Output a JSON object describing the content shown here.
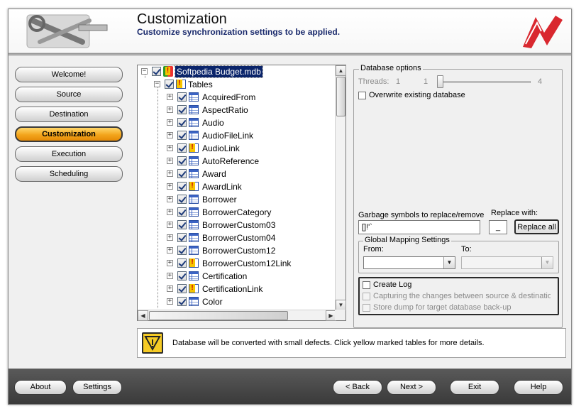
{
  "header": {
    "title": "Customization",
    "subtitle": "Customize synchronization settings to be applied."
  },
  "nav": [
    {
      "label": "Welcome!",
      "active": false
    },
    {
      "label": "Source",
      "active": false
    },
    {
      "label": "Destination",
      "active": false
    },
    {
      "label": "Customization",
      "active": true
    },
    {
      "label": "Execution",
      "active": false
    },
    {
      "label": "Scheduling",
      "active": false
    }
  ],
  "tree": {
    "root": "Softpedia Budget.mdb",
    "tables_node": "Tables",
    "items": [
      {
        "label": "AcquiredFrom",
        "icon": "table-icon"
      },
      {
        "label": "AspectRatio",
        "icon": "table-icon"
      },
      {
        "label": "Audio",
        "icon": "table-icon"
      },
      {
        "label": "AudioFileLink",
        "icon": "table-icon"
      },
      {
        "label": "AudioLink",
        "icon": "warning-table-icon"
      },
      {
        "label": "AutoReference",
        "icon": "table-icon"
      },
      {
        "label": "Award",
        "icon": "table-icon"
      },
      {
        "label": "AwardLink",
        "icon": "warning-table-icon"
      },
      {
        "label": "Borrower",
        "icon": "table-icon"
      },
      {
        "label": "BorrowerCategory",
        "icon": "table-icon"
      },
      {
        "label": "BorrowerCustom03",
        "icon": "table-icon"
      },
      {
        "label": "BorrowerCustom04",
        "icon": "table-icon"
      },
      {
        "label": "BorrowerCustom12",
        "icon": "table-icon"
      },
      {
        "label": "BorrowerCustom12Link",
        "icon": "warning-table-icon"
      },
      {
        "label": "Certification",
        "icon": "table-icon"
      },
      {
        "label": "CertificationLink",
        "icon": "warning-table-icon"
      },
      {
        "label": "Color",
        "icon": "table-icon"
      }
    ]
  },
  "options": {
    "database_options_title": "Database options",
    "threads_label": "Threads:",
    "threads_value": "1",
    "threads_min": "1",
    "threads_max": "4",
    "overwrite_label": "Overwrite existing database",
    "garbage_label": "Garbage symbols to replace/remove",
    "garbage_value": "[]!'`",
    "replace_with_label": "Replace with:",
    "replace_with_value": "_",
    "replace_all_label": "Replace all",
    "mapping_title": "Global Mapping Settings",
    "from_label": "From:",
    "to_label": "To:",
    "create_log_label": "Create Log",
    "capture_label": "Capturing the changes between source & destination",
    "dump_label": "Store dump for target database back-up"
  },
  "message": "Database will be converted with small defects. Click yellow marked tables for more details.",
  "footer": {
    "about": "About",
    "settings": "Settings",
    "back": "< Back",
    "next": "Next >",
    "exit": "Exit",
    "help": "Help"
  },
  "colors": {
    "active_nav": "#f3a51c",
    "subtitle": "#1a2a6c",
    "selection": "#0a246a",
    "footer": "#4a4a4a"
  }
}
